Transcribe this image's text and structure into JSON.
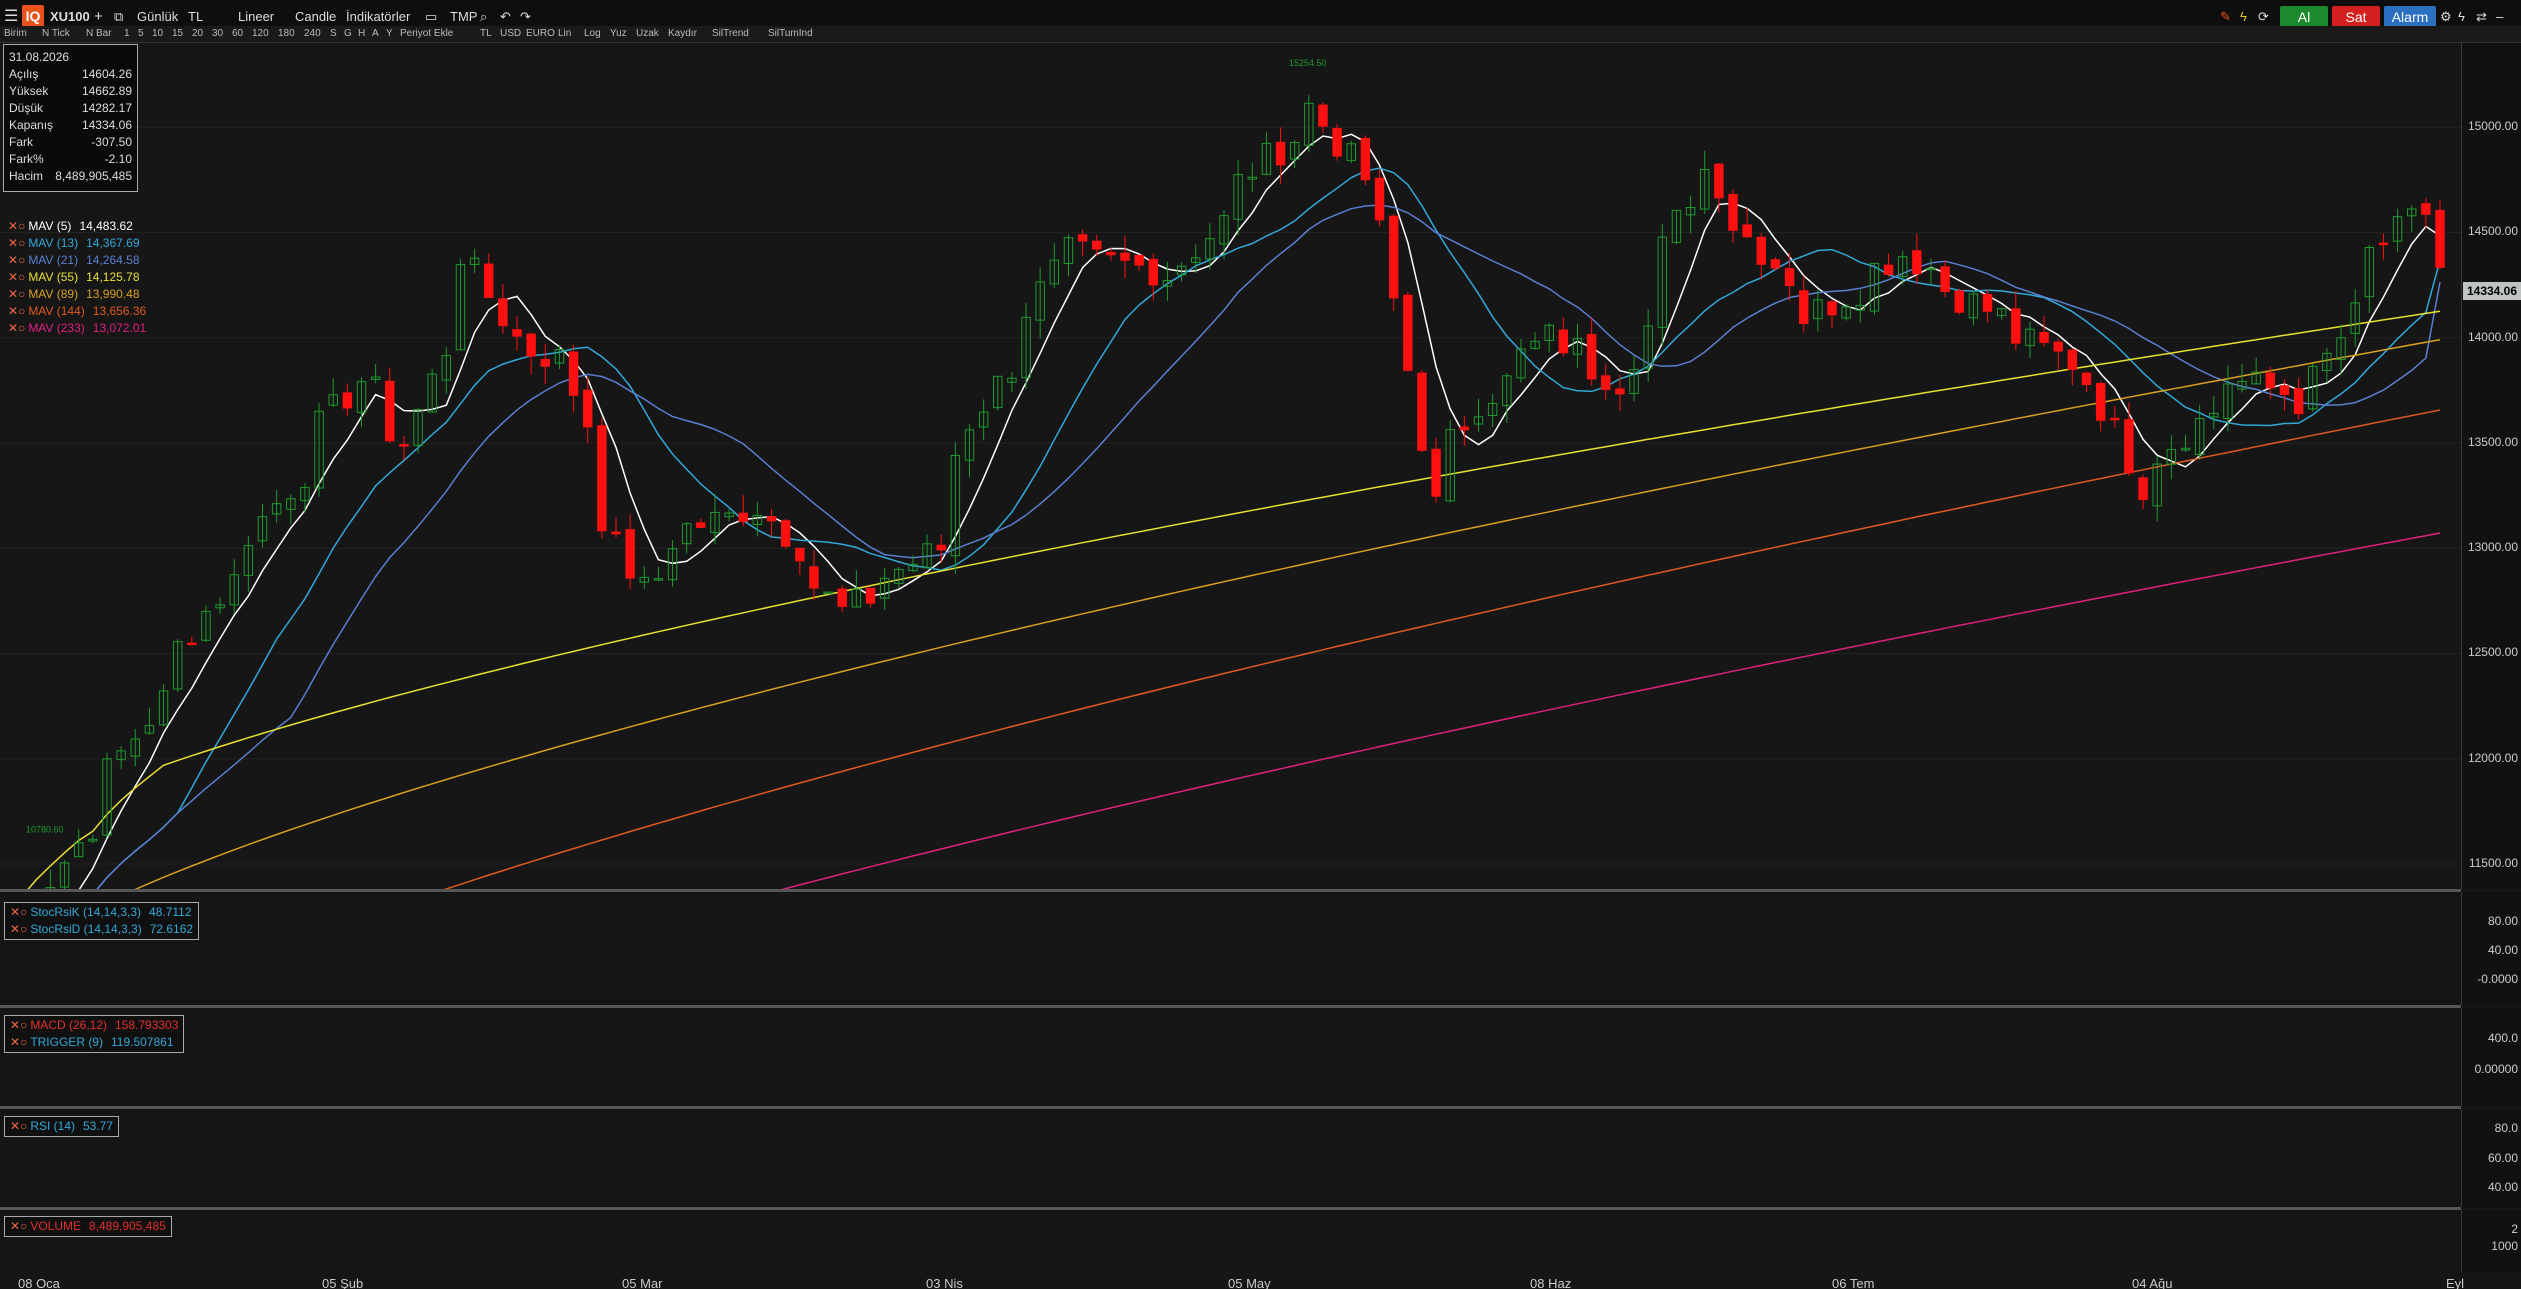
{
  "toolbar": {
    "logo": "IQ",
    "symbol": "XU100",
    "add": "+",
    "period": "Günlük",
    "currency": "TL",
    "scale": "Lineer",
    "chart_type": "Candle",
    "indicators": "İndikatörler",
    "template": "TMP",
    "buy": "Al",
    "sell": "Sat",
    "alarm": "Alarm",
    "colors": {
      "buy": "#1c8a2c",
      "sell": "#d42020",
      "alarm": "#2a6fc0",
      "logo": "#e8521b"
    }
  },
  "toolbar2": [
    "Birim",
    "N Tick",
    "N Bar",
    "1",
    "5",
    "10",
    "15",
    "20",
    "30",
    "60",
    "120",
    "180",
    "240",
    "S",
    "G",
    "H",
    "A",
    "Y",
    "Periyot Ekle",
    "TL",
    "USD",
    "EURO",
    "Lin",
    "Log",
    "Yuz",
    "Uzak",
    "Kaydır",
    "SilTrend",
    "SilTumInd"
  ],
  "ohlc": {
    "date": "31.08.2026",
    "rows": [
      {
        "label": "Açılış",
        "value": "14604.26"
      },
      {
        "label": "Yüksek",
        "value": "14662.89"
      },
      {
        "label": "Düşük",
        "value": "14282.17"
      },
      {
        "label": "Kapanış",
        "value": "14334.06"
      },
      {
        "label": "Fark",
        "value": "-307.50"
      },
      {
        "label": "Fark%",
        "value": "-2.10"
      },
      {
        "label": "Hacim",
        "value": "8,489,905,485"
      }
    ]
  },
  "mav_legend": [
    {
      "label": "MAV (5)",
      "value": "14,483.62",
      "color": "#ffffff"
    },
    {
      "label": "MAV (13)",
      "value": "14,367.69",
      "color": "#32a8d8"
    },
    {
      "label": "MAV (21)",
      "value": "14,264.58",
      "color": "#5a7fd0"
    },
    {
      "label": "MAV (55)",
      "value": "14,125.78",
      "color": "#e8e030"
    },
    {
      "label": "MAV (89)",
      "value": "13,990.48",
      "color": "#d8a020"
    },
    {
      "label": "MAV (144)",
      "value": "13,656.36",
      "color": "#e05a20"
    },
    {
      "label": "MAV (233)",
      "value": "13,072.01",
      "color": "#e02080"
    }
  ],
  "price_axis": [
    "15000.00",
    "14500.00",
    "14000.00",
    "13500.00",
    "13000.00",
    "12500.00",
    "12000.00",
    "11500.00"
  ],
  "last_price": "14334.06",
  "chart_labels": {
    "high": "15254.50",
    "low": "10780.60"
  },
  "stoch": {
    "legend": [
      {
        "label": "StocRsiK (14,14,3,3)",
        "value": "48.7112",
        "color": "#32a8d8"
      },
      {
        "label": "StocRsiD (14,14,3,3)",
        "value": "72.6162",
        "color": "#32a8d8"
      }
    ],
    "axis": [
      "80.00",
      "40.00",
      "-0.0000"
    ]
  },
  "macd": {
    "legend": [
      {
        "label": "MACD (26,12)",
        "value": "158.793303",
        "color": "#e03030"
      },
      {
        "label": "TRIGGER (9)",
        "value": "119.507861",
        "color": "#32a8d8"
      }
    ],
    "axis": [
      "400.0",
      "0.00000"
    ]
  },
  "rsi": {
    "legend": [
      {
        "label": "RSI (14)",
        "value": "53.77",
        "color": "#32a8d8"
      }
    ],
    "axis": [
      "80.0",
      "60.00",
      "40.00"
    ]
  },
  "volume": {
    "legend": [
      {
        "label": "VOLUME",
        "value": "8,489,905,485",
        "color": "#e03030"
      }
    ],
    "axis": [
      "2",
      "1000"
    ]
  },
  "x_labels": [
    "08 Oca",
    "05 Şub",
    "05 Mar",
    "03 Nis",
    "05 May",
    "08 Haz",
    "06 Tem",
    "04 Ağu",
    "Eyl"
  ],
  "chart_data": {
    "type": "candlestick",
    "period": "daily",
    "ylim": [
      11400,
      15400
    ],
    "keypoints": [
      {
        "date": "01.01.2026",
        "close": 11000
      },
      {
        "date": "08.01.2026",
        "close": 11600
      },
      {
        "date": "21.01.2026",
        "close": 12700
      },
      {
        "date": "05.02.2026",
        "close": 13800
      },
      {
        "date": "10.02.2026",
        "close": 13500
      },
      {
        "date": "16.02.2026",
        "close": 14400
      },
      {
        "date": "20.02.2026",
        "close": 14000
      },
      {
        "date": "25.02.2026",
        "close": 13900
      },
      {
        "date": "03.03.2026",
        "close": 13000
      },
      {
        "date": "05.03.2026",
        "close": 12800
      },
      {
        "date": "10.03.2026",
        "close": 13100
      },
      {
        "date": "17.03.2026",
        "close": 13200
      },
      {
        "date": "25.03.2026",
        "close": 12700
      },
      {
        "date": "03.04.2026",
        "close": 13000
      },
      {
        "date": "07.04.2026",
        "close": 13600
      },
      {
        "date": "16.04.2026",
        "close": 14400
      },
      {
        "date": "27.04.2026",
        "close": 14300
      },
      {
        "date": "05.05.2026",
        "close": 14800
      },
      {
        "date": "11.05.2026",
        "close": 15100
      },
      {
        "date": "18.05.2026",
        "close": 14500
      },
      {
        "date": "22.05.2026",
        "close": 13200
      },
      {
        "date": "27.05.2026",
        "close": 13700
      },
      {
        "date": "03.06.2026",
        "close": 14000
      },
      {
        "date": "10.06.2026",
        "close": 13800
      },
      {
        "date": "18.06.2026",
        "close": 14800
      },
      {
        "date": "29.06.2026",
        "close": 14100
      },
      {
        "date": "08.07.2026",
        "close": 14400
      },
      {
        "date": "20.07.2026",
        "close": 14000
      },
      {
        "date": "27.07.2026",
        "close": 13800
      },
      {
        "date": "31.07.2026",
        "close": 13300
      },
      {
        "date": "10.08.2026",
        "close": 13800
      },
      {
        "date": "17.08.2026",
        "close": 13700
      },
      {
        "date": "24.08.2026",
        "close": 14400
      },
      {
        "date": "28.08.2026",
        "close": 14600
      },
      {
        "date": "31.08.2026",
        "close": 14334
      }
    ],
    "moving_averages": [
      {
        "name": "MAV (5)",
        "last": 14483.62
      },
      {
        "name": "MAV (13)",
        "last": 14367.69
      },
      {
        "name": "MAV (21)",
        "last": 14264.58
      },
      {
        "name": "MAV (55)",
        "last": 14125.78
      },
      {
        "name": "MAV (89)",
        "last": 13990.48
      },
      {
        "name": "MAV (144)",
        "last": 13656.36
      },
      {
        "name": "MAV (233)",
        "last": 13072.01
      }
    ],
    "indicators": {
      "stoch_rsi_k": 48.7112,
      "stoch_rsi_d": 72.6162,
      "macd": 158.793303,
      "trigger": 119.507861,
      "rsi": 53.77,
      "volume": 8489905485
    }
  }
}
